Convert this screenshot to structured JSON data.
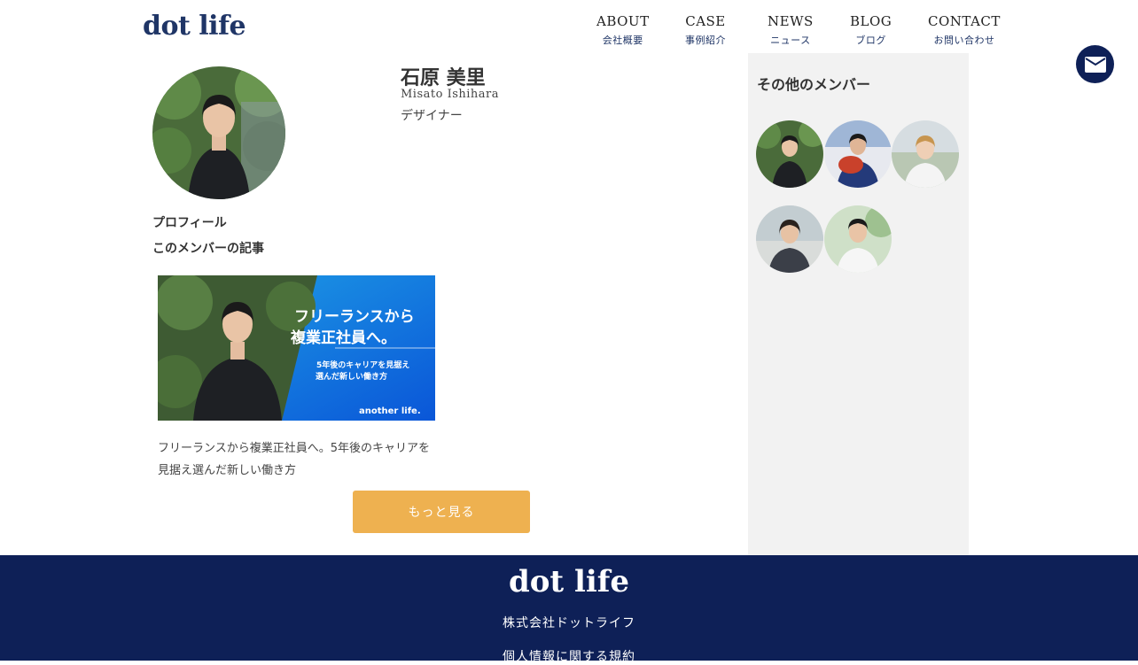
{
  "header": {
    "logo": "dot life",
    "nav": [
      {
        "en": "ABOUT",
        "ja": "会社概要"
      },
      {
        "en": "CASE",
        "ja": "事例紹介"
      },
      {
        "en": "NEWS",
        "ja": "ニュース"
      },
      {
        "en": "BLOG",
        "ja": "ブログ"
      },
      {
        "en": "CONTACT",
        "ja": "お問い合わせ"
      }
    ],
    "mail_icon": "envelope-icon"
  },
  "profile": {
    "name": "石原 美里",
    "romaji": "Misato Ishihara",
    "role": "デザイナー",
    "profile_label": "プロフィール",
    "articles_label": "このメンバーの記事"
  },
  "article": {
    "image_headline_1": "フリーランスから",
    "image_headline_2": "複業正社員へ。",
    "image_sub_1": "5年後のキャリアを見据え",
    "image_sub_2": "選んだ新しい働き方",
    "image_brand": "another life.",
    "title": "フリーランスから複業正社員へ。5年後のキャリアを見据え選んだ新しい働き方"
  },
  "more_button": "もっと見る",
  "sidebar": {
    "title": "その他のメンバー"
  },
  "footer": {
    "logo": "dot life",
    "company": "株式会社ドットライフ",
    "privacy": "個人情報に関する規約"
  },
  "colors": {
    "navy": "#0e2057",
    "accent": "#eeb150",
    "sidebar_bg": "#f2f2f2"
  }
}
